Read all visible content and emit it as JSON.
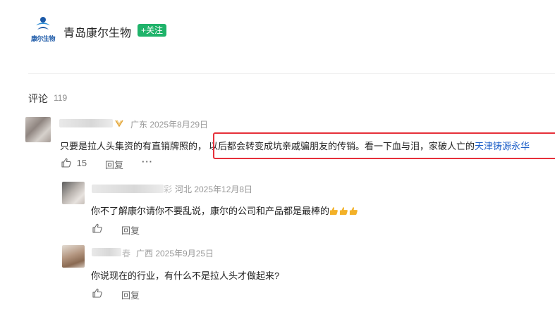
{
  "header": {
    "logo_text": "康尔生物",
    "company_name": "青岛康尔生物",
    "follow_label": "+关注"
  },
  "comments": {
    "title": "评论",
    "count": "119",
    "items": [
      {
        "location_date": "广东 2025年8月29日",
        "text_before": "只要是拉人头集资的有直销牌照的，",
        "text_highlight": "以后都会转变成坑亲戚骗朋友的传销。看一下血与泪，家破人亡的",
        "text_link": "天津铸源永华",
        "likes": "15",
        "reply_label": "回复",
        "more_label": "···"
      }
    ],
    "replies": [
      {
        "name_tail": "彩",
        "location_date": "河北 2025年12月8日",
        "text": "你不了解康尔请你不要乱说，康尔的公司和产品都是最棒的",
        "reply_label": "回复"
      },
      {
        "name_tail": "春",
        "location_date": "广西 2025年9月25日",
        "text": "你说现在的行业，有什么不是拉人头才做起来?",
        "reply_label": "回复"
      }
    ]
  },
  "colors": {
    "accent_green": "#1fb36a",
    "highlight_red": "#e6303a",
    "link_blue": "#1d5fc8"
  },
  "icons": [
    "company-logo",
    "gold-badge-icon",
    "thumbs-up-icon",
    "more-dots-icon",
    "thumbs-up-emoji"
  ]
}
